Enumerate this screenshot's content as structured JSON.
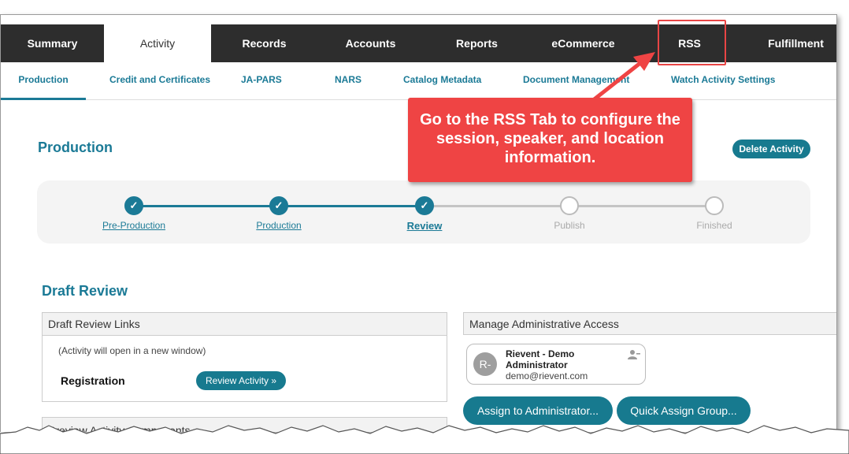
{
  "top_tabs": [
    {
      "label": "Summary"
    },
    {
      "label": "Activity"
    },
    {
      "label": "Records"
    },
    {
      "label": "Accounts"
    },
    {
      "label": "Reports"
    },
    {
      "label": "eCommerce"
    },
    {
      "label": "RSS"
    },
    {
      "label": "Fulfillment"
    }
  ],
  "sub_tabs": [
    {
      "label": "Production"
    },
    {
      "label": "Credit and Certificates"
    },
    {
      "label": "JA-PARS"
    },
    {
      "label": "NARS"
    },
    {
      "label": "Catalog Metadata"
    },
    {
      "label": "Document Management"
    },
    {
      "label": "Watch Activity Settings"
    }
  ],
  "page": {
    "title": "Production",
    "delete_label": "Delete Activity"
  },
  "stepper": {
    "steps": [
      {
        "label": "Pre-Production",
        "state": "done"
      },
      {
        "label": "Production",
        "state": "done"
      },
      {
        "label": "Review",
        "state": "current"
      },
      {
        "label": "Publish",
        "state": "todo"
      },
      {
        "label": "Finished",
        "state": "todo"
      }
    ],
    "check_glyph": "✓"
  },
  "draft_review": {
    "title": "Draft Review",
    "links_panel_title": "Draft Review Links",
    "note": "(Activity will open in a new window)",
    "registration_label": "Registration",
    "review_button": "Review Activity »"
  },
  "admin_access": {
    "panel_title": "Manage Administrative Access",
    "admin": {
      "initials": "R-",
      "name": "Rievent - Demo Administrator",
      "email": "demo@rievent.com"
    },
    "assign_button": "Assign to Administrator...",
    "quick_assign_button": "Quick Assign Group..."
  },
  "preview_panel_title": "Preview Activity Components",
  "annotation": {
    "callout_text": "Go to the RSS Tab to configure the session, speaker, and location information."
  },
  "colors": {
    "accent": "#1b7a96",
    "nav_bg": "#2d2d2d",
    "callout": "#ef4444"
  }
}
